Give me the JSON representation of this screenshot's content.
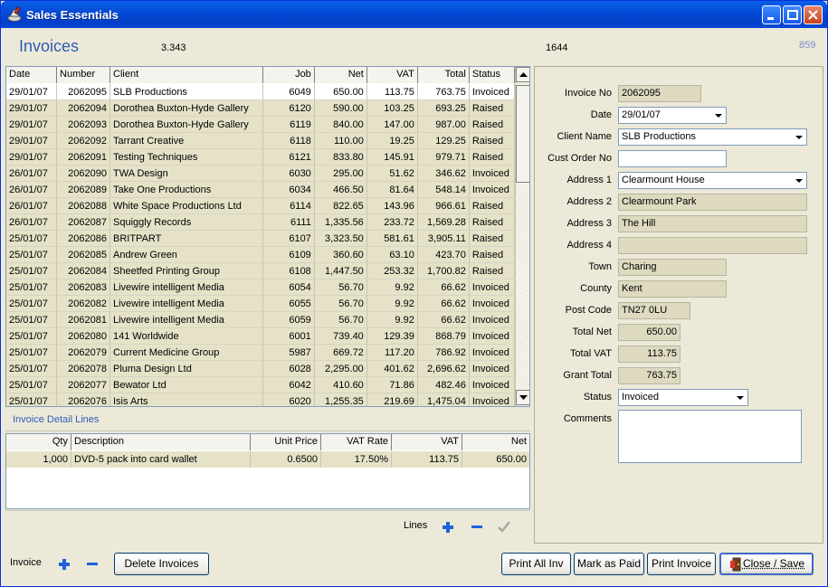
{
  "window": {
    "title": "Sales Essentials"
  },
  "header": {
    "page_title": "Invoices",
    "value_left": "3.343",
    "value_mid": "1644",
    "value_right": "859"
  },
  "invoice_grid": {
    "columns": [
      "Date",
      "Number",
      "Client",
      "Job",
      "Net",
      "VAT",
      "Total",
      "Status"
    ],
    "rows": [
      [
        "29/01/07",
        "2062095",
        "SLB Productions",
        "6049",
        "650.00",
        "113.75",
        "763.75",
        "Invoiced"
      ],
      [
        "29/01/07",
        "2062094",
        "Dorothea Buxton-Hyde Gallery",
        "6120",
        "590.00",
        "103.25",
        "693.25",
        "Raised"
      ],
      [
        "29/01/07",
        "2062093",
        "Dorothea Buxton-Hyde Gallery",
        "6119",
        "840.00",
        "147.00",
        "987.00",
        "Raised"
      ],
      [
        "29/01/07",
        "2062092",
        "Tarrant Creative",
        "6118",
        "110.00",
        "19.25",
        "129.25",
        "Raised"
      ],
      [
        "29/01/07",
        "2062091",
        "Testing Techniques",
        "6121",
        "833.80",
        "145.91",
        "979.71",
        "Raised"
      ],
      [
        "26/01/07",
        "2062090",
        "TWA Design",
        "6030",
        "295.00",
        "51.62",
        "346.62",
        "Invoiced"
      ],
      [
        "26/01/07",
        "2062089",
        "Take One Productions",
        "6034",
        "466.50",
        "81.64",
        "548.14",
        "Invoiced"
      ],
      [
        "26/01/07",
        "2062088",
        "White Space Productions Ltd",
        "6114",
        "822.65",
        "143.96",
        "966.61",
        "Raised"
      ],
      [
        "26/01/07",
        "2062087",
        "Squiggly Records",
        "6111",
        "1,335.56",
        "233.72",
        "1,569.28",
        "Raised"
      ],
      [
        "25/01/07",
        "2062086",
        "BRITPART",
        "6107",
        "3,323.50",
        "581.61",
        "3,905.11",
        "Raised"
      ],
      [
        "25/01/07",
        "2062085",
        "Andrew Green",
        "6109",
        "360.60",
        "63.10",
        "423.70",
        "Raised"
      ],
      [
        "25/01/07",
        "2062084",
        "Sheetfed Printing Group",
        "6108",
        "1,447.50",
        "253.32",
        "1,700.82",
        "Raised"
      ],
      [
        "25/01/07",
        "2062083",
        "Livewire intelligent Media",
        "6054",
        "56.70",
        "9.92",
        "66.62",
        "Invoiced"
      ],
      [
        "25/01/07",
        "2062082",
        "Livewire intelligent Media",
        "6055",
        "56.70",
        "9.92",
        "66.62",
        "Invoiced"
      ],
      [
        "25/01/07",
        "2062081",
        "Livewire intelligent Media",
        "6059",
        "56.70",
        "9.92",
        "66.62",
        "Invoiced"
      ],
      [
        "25/01/07",
        "2062080",
        "141 Worldwide",
        "6001",
        "739.40",
        "129.39",
        "868.79",
        "Invoiced"
      ],
      [
        "25/01/07",
        "2062079",
        "Current Medicine Group",
        "5987",
        "669.72",
        "117.20",
        "786.92",
        "Invoiced"
      ],
      [
        "25/01/07",
        "2062078",
        "Pluma Design Ltd",
        "6028",
        "2,295.00",
        "401.62",
        "2,696.62",
        "Invoiced"
      ],
      [
        "25/01/07",
        "2062077",
        "Bewator Ltd",
        "6042",
        "410.60",
        "71.86",
        "482.46",
        "Invoiced"
      ],
      [
        "25/01/07",
        "2062076",
        "Isis Arts",
        "6020",
        "1,255.35",
        "219.69",
        "1,475.04",
        "Invoiced"
      ]
    ]
  },
  "detail": {
    "title": "Invoice Detail Lines",
    "columns": [
      "Qty",
      "Description",
      "Unit Price",
      "VAT Rate",
      "VAT",
      "Net"
    ],
    "rows": [
      [
        "1,000",
        "DVD-5 pack into card wallet",
        "0.6500",
        "17.50%",
        "113.75",
        "650.00"
      ]
    ],
    "lines_label": "Lines"
  },
  "form": {
    "invoice_no_label": "Invoice No",
    "invoice_no": "2062095",
    "date_label": "Date",
    "date": "29/01/07",
    "client_name_label": "Client Name",
    "client_name": "SLB Productions",
    "cust_order_label": "Cust Order No",
    "cust_order": "",
    "address1_label": "Address 1",
    "address1": "Clearmount House",
    "address2_label": "Address 2",
    "address2": "Clearmount Park",
    "address3_label": "Address 3",
    "address3": "The Hill",
    "address4_label": "Address 4",
    "address4": "",
    "town_label": "Town",
    "town": "Charing",
    "county_label": "County",
    "county": "Kent",
    "post_code_label": "Post Code",
    "post_code": "TN27 0LU",
    "total_net_label": "Total Net",
    "total_net": "650.00",
    "total_vat_label": "Total VAT",
    "total_vat": "113.75",
    "grant_total_label": "Grant Total",
    "grant_total": "763.75",
    "status_label": "Status",
    "status": "Invoiced",
    "comments_label": "Comments"
  },
  "footer": {
    "invoice_label": "Invoice",
    "delete_invoices": "Delete Invoices",
    "print_all": "Print All Inv",
    "mark_paid": "Mark as Paid",
    "print_invoice": "Print Invoice",
    "close_save": "Close / Save"
  },
  "colors": {
    "title_blue": "#2e5db8",
    "row_fill": "#e5e2c8",
    "selected_row": "#ffffff",
    "icon_blue": "#1e64d8"
  }
}
